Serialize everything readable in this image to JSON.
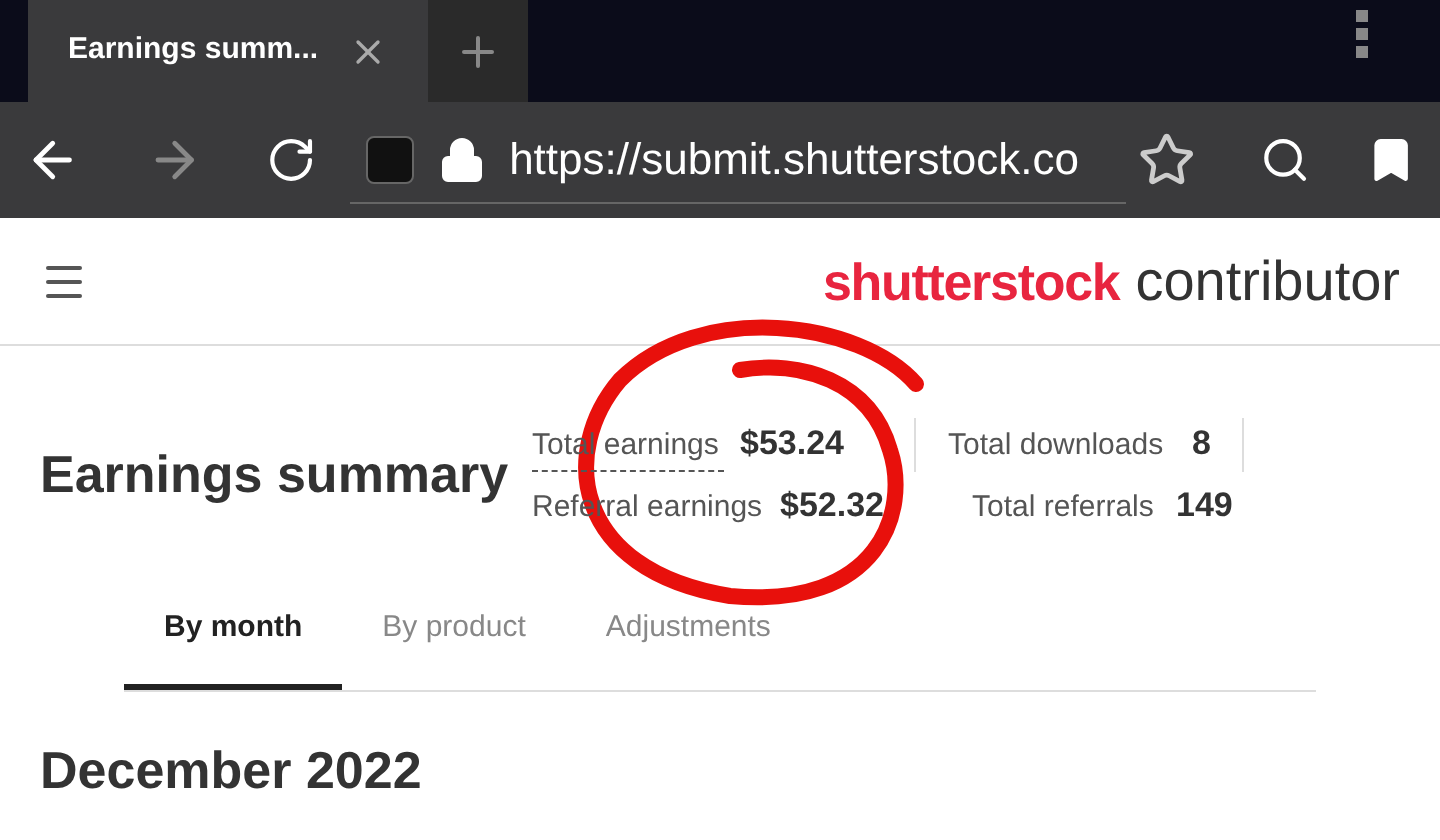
{
  "browser": {
    "tab": {
      "title": "Earnings summ...",
      "selected": true
    },
    "url": "https://submit.shutterstock.co"
  },
  "header": {
    "brand": "shutterstock",
    "product": "contributor"
  },
  "summary": {
    "title": "Earnings summary",
    "stats": [
      {
        "label": "Total earnings",
        "value": "$53.24",
        "underlined": true
      },
      {
        "label": "Total downloads",
        "value": "8",
        "underlined": false
      },
      {
        "label": "Referral earnings",
        "value": "$52.32",
        "underlined": false
      },
      {
        "label": "Total referrals",
        "value": "149",
        "underlined": false
      }
    ]
  },
  "tabs": [
    {
      "label": "By month",
      "selected": true
    },
    {
      "label": "By product",
      "selected": false
    },
    {
      "label": "Adjustments",
      "selected": false
    }
  ],
  "section_title": "December 2022",
  "annotation": {
    "kind": "circle"
  }
}
